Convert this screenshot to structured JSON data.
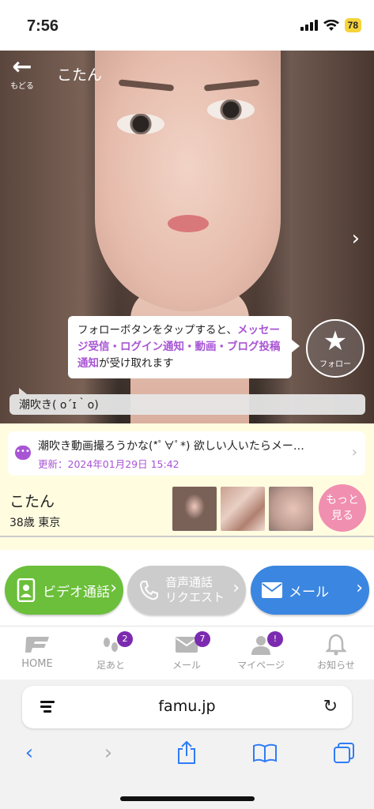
{
  "status_bar": {
    "time": "7:56",
    "battery": "78"
  },
  "header": {
    "back_label": "もどる",
    "title": "こたん"
  },
  "follow": {
    "tip_part1": "フォローボタンをタップすると、",
    "tip_highlight": "メッセージ受信・ログイン通知・動画・ブログ投稿通知",
    "tip_part2": "が受け取れます",
    "button_label": "フォロー"
  },
  "status_message": "潮吹き( ο´ɪ｀ο)",
  "latest_post": {
    "text": "潮吹き動画撮ろうかな(*ﾟ∀ﾟ*) 欲しい人いたらメー…",
    "date": "更新：2024年01月29日 15:42"
  },
  "profile": {
    "name": "こたん",
    "info": "38歳 東京",
    "more_label": "もっと見る"
  },
  "actions": {
    "video_call": "ビデオ通話",
    "voice_call_line1": "音声通話",
    "voice_call_line2": "リクエスト",
    "mail": "メール"
  },
  "tabs": [
    {
      "label": "HOME"
    },
    {
      "label": "足あと",
      "badge": "2"
    },
    {
      "label": "メール",
      "badge": "7"
    },
    {
      "label": "マイページ",
      "badge": "!"
    },
    {
      "label": "お知らせ"
    }
  ],
  "browser": {
    "url": "famu.jp"
  },
  "colors": {
    "accent": "#a855d4",
    "video": "#6bbf3a",
    "mail": "#3b86e0",
    "more": "#f08fb0"
  }
}
